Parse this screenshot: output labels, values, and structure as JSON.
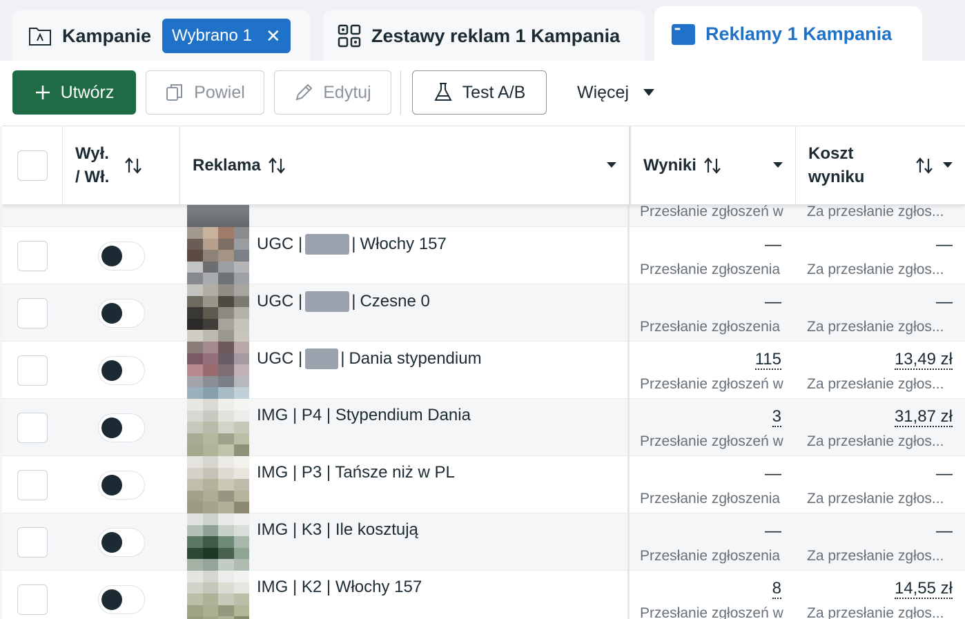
{
  "tabs": {
    "campaigns": {
      "title": "Kampanie",
      "chip": "Wybrano 1",
      "chip_close": "✕"
    },
    "adsets": {
      "title": "Zestawy reklam 1 Kampania"
    },
    "ads": {
      "title": "Reklamy 1 Kampania",
      "active": true
    }
  },
  "toolbar": {
    "create": "Utwórz",
    "duplicate": "Powiel",
    "edit": "Edytuj",
    "ab_test": "Test A/B",
    "more": "Więcej"
  },
  "table": {
    "headers": {
      "toggle_line1": "Wył.",
      "toggle_line2": "/ Wł.",
      "ad": "Reklama",
      "results": "Wyniki",
      "cost_line1": "Koszt",
      "cost_line2": "wyniku"
    },
    "partial_row": {
      "results_sub": "Przesłanie zgłoszeń w",
      "cost_sub": "Za przesłanie zgłos..."
    },
    "rows": [
      {
        "name_prefix": "UGC |",
        "name_suffix": "Włochy 157",
        "results": "—",
        "results_sub": "Przesłanie zgłoszenia",
        "cost": "—",
        "cost_sub": "Za przesłanie zgłos...",
        "toggle": "off"
      },
      {
        "name_prefix": "UGC |",
        "name_suffix": "Czesne 0",
        "results": "—",
        "results_sub": "Przesłanie zgłoszenia",
        "cost": "—",
        "cost_sub": "Za przesłanie zgłos...",
        "toggle": "off"
      },
      {
        "name_prefix": "UGC |",
        "name_suffix": "Dania stypendium",
        "results": "115",
        "results_sub": "Przesłanie zgłoszeń w",
        "cost": "13,49 zł",
        "cost_sub": "Za przesłanie zgłos...",
        "toggle": "off"
      },
      {
        "name_prefix": "",
        "name_suffix": "IMG | P4 | Stypendium Dania",
        "results": "3",
        "results_sub": "Przesłanie zgłoszeń w",
        "cost": "31,87 zł",
        "cost_sub": "Za przesłanie zgłos...",
        "toggle": "off"
      },
      {
        "name_prefix": "",
        "name_suffix": "IMG | P3 | Tańsze niż w PL",
        "results": "—",
        "results_sub": "Przesłanie zgłoszenia",
        "cost": "—",
        "cost_sub": "Za przesłanie zgłos...",
        "toggle": "off"
      },
      {
        "name_prefix": "",
        "name_suffix": "IMG | K3 | Ile kosztują",
        "results": "—",
        "results_sub": "Przesłanie zgłoszenia",
        "cost": "—",
        "cost_sub": "Za przesłanie zgłos...",
        "toggle": "off"
      },
      {
        "name_prefix": "",
        "name_suffix": "IMG | K2 | Włochy 157",
        "results": "8",
        "results_sub": "Przesłanie zgłoszeń w",
        "cost": "14,55 zł",
        "cost_sub": "Za przesłanie zgłos...",
        "toggle": "off"
      }
    ]
  },
  "colors": {
    "primary_blue": "#1f72c7",
    "create_green": "#1e6b45",
    "text_dark": "#1c2b33",
    "text_muted": "#67717a"
  }
}
